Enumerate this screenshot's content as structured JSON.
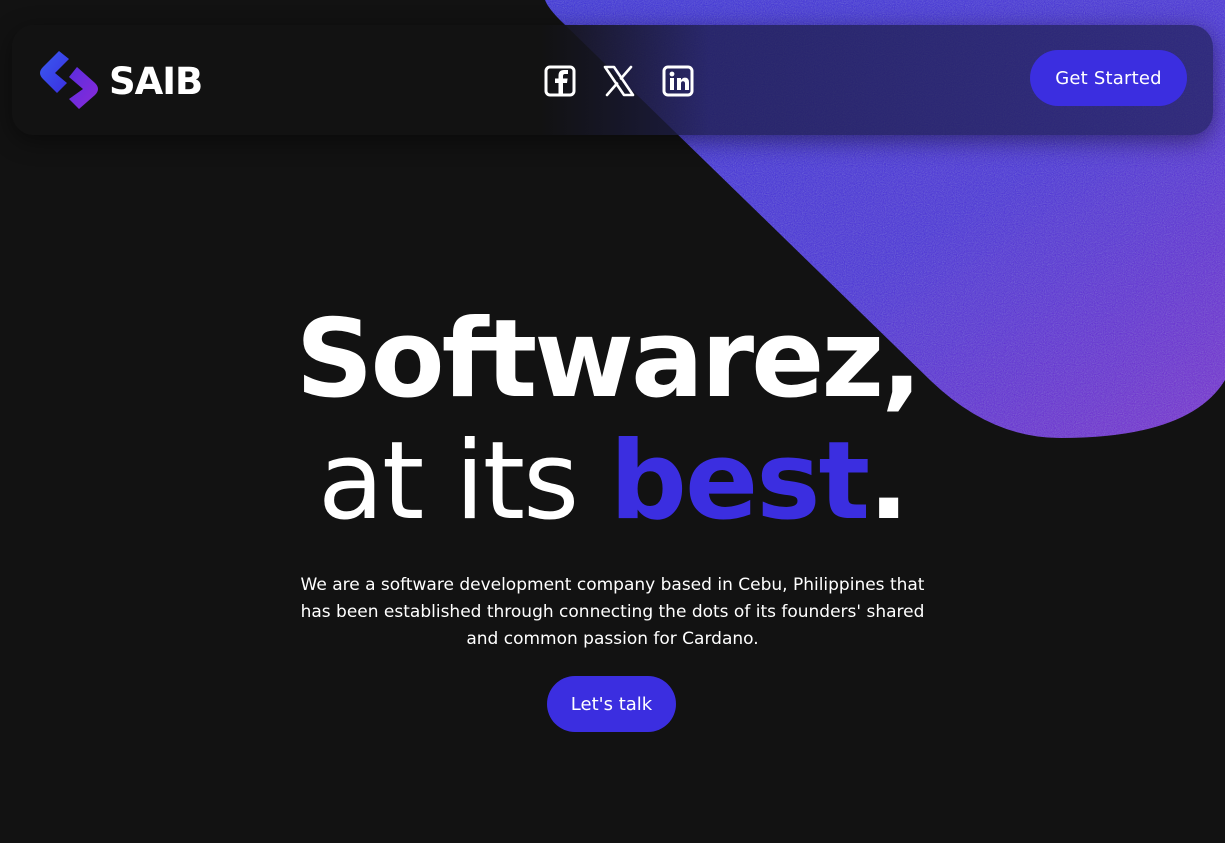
{
  "header": {
    "logo_text": "SAIB",
    "social": [
      {
        "icon": "facebook-icon"
      },
      {
        "icon": "x-twitter-icon"
      },
      {
        "icon": "linkedin-icon"
      }
    ],
    "cta_label": "Get Started"
  },
  "hero": {
    "line1": "Softwarez,",
    "line2_plain": "at its ",
    "line2_accent": "best",
    "line2_end": ".",
    "description": "We are a software development company based in Cebu, Philippines that has been established through connecting the dots of its founders' shared and common passion for Cardano.",
    "button_label": "Let's talk"
  },
  "colors": {
    "background": "#121212",
    "accent": "#3b2ee0",
    "blob_start": "#3a2fd8",
    "blob_end": "#7a2ad0",
    "text": "#ffffff"
  }
}
